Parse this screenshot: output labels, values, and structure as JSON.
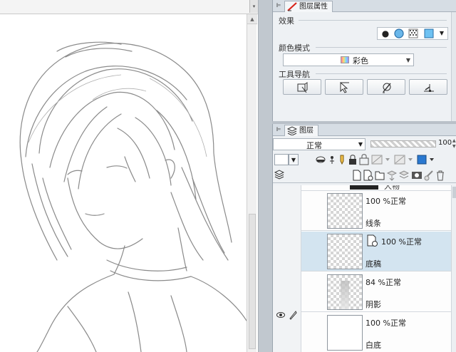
{
  "canvas": {
    "menu_arrow": "▾",
    "scroll_up": "▲"
  },
  "property_panel": {
    "tab_label": "图层属性",
    "effect_label": "效果",
    "color_mode_label": "颜色模式",
    "color_mode_value": "彩色",
    "tool_nav_label": "工具导航",
    "tool_buttons": [
      "layer-move-icon",
      "select-arrow-icon",
      "mask-edit-icon",
      "ruler-icon"
    ]
  },
  "layer_panel": {
    "tab_label": "图层",
    "blend_mode": "正常",
    "opacity": "100",
    "group_name": "人物",
    "layers": [
      {
        "opacity_blend": "100 %正常",
        "name": "线条",
        "selected": false
      },
      {
        "opacity_blend": "100 %正常",
        "name": "底稿",
        "selected": true
      },
      {
        "opacity_blend": "84 %正常",
        "name": "阴影",
        "selected": false
      },
      {
        "opacity_blend": "100 %正常",
        "name": "白底",
        "selected": false
      }
    ]
  },
  "colors": {
    "accent_selected": "#d3e4f0",
    "panel_bg": "#eef1f4",
    "brush_red": "#d9261c"
  }
}
